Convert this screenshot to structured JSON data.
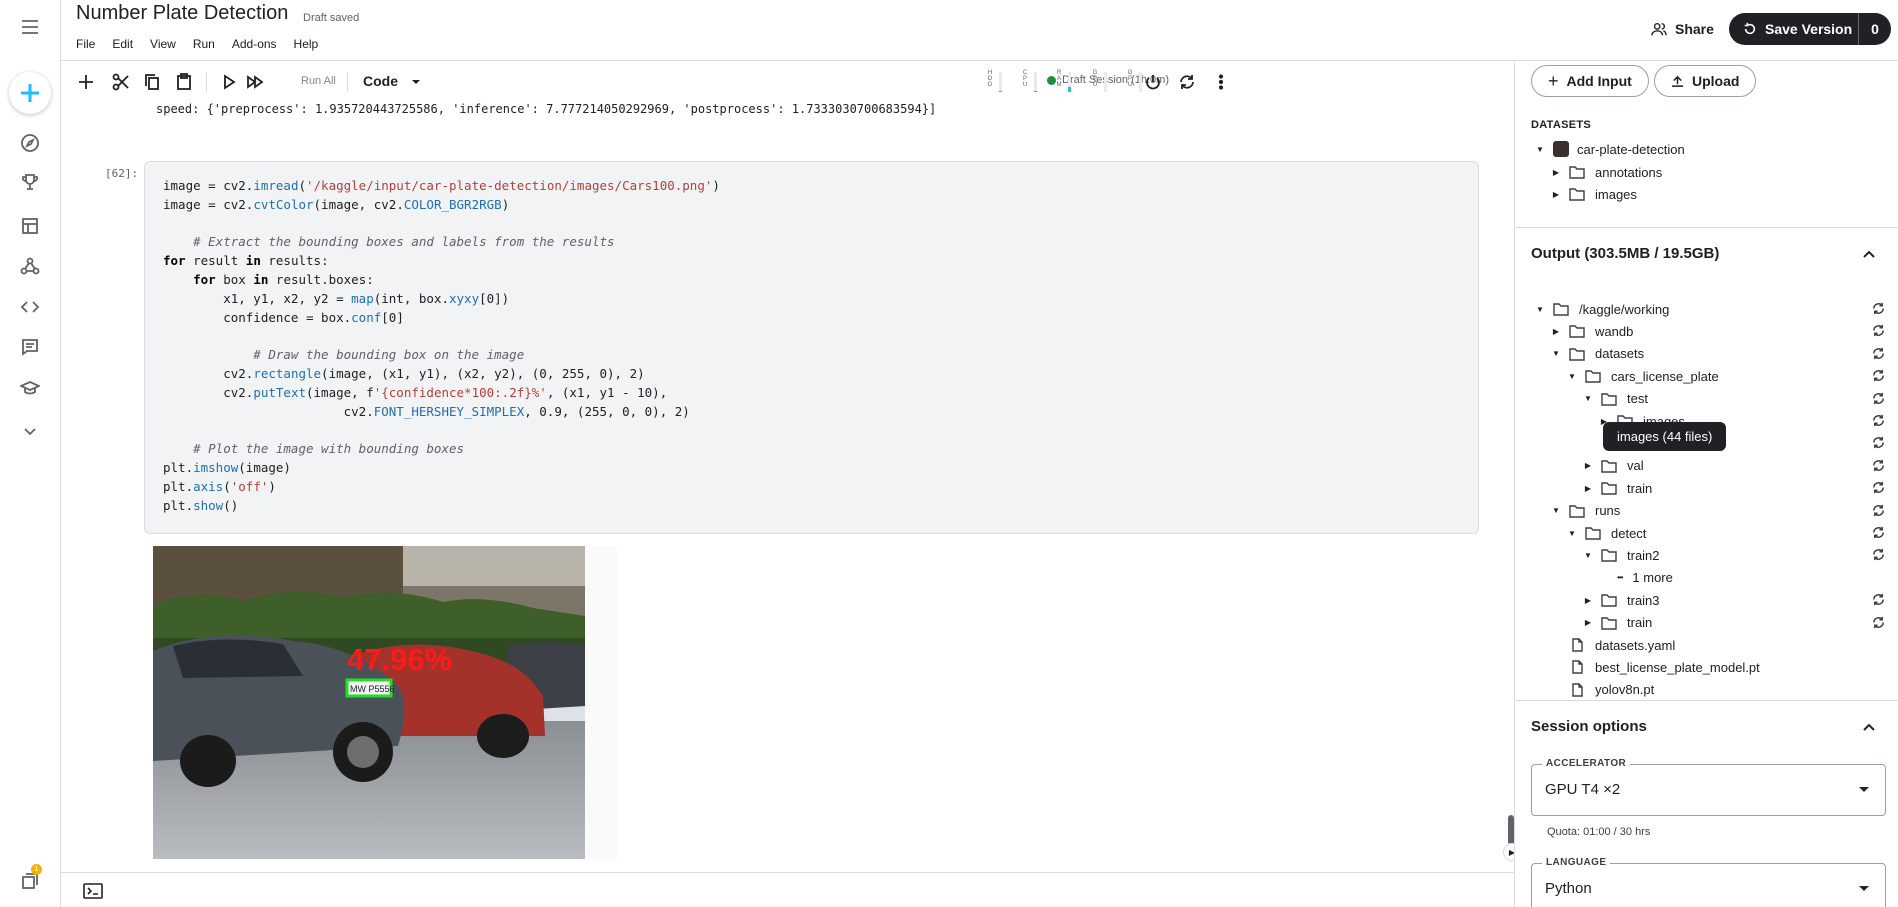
{
  "header": {
    "title": "Number Plate Detection",
    "draft_status": "Draft saved",
    "menu": [
      "File",
      "Edit",
      "View",
      "Run",
      "Add-ons",
      "Help"
    ],
    "share_label": "Share",
    "save_label": "Save Version",
    "save_count": "0"
  },
  "toolbar": {
    "run_all_label": "Run All",
    "cell_type": "Code",
    "session_label": "Draft Session (1h:0m)",
    "meters": [
      {
        "label": "HDD",
        "level": 0.05
      },
      {
        "label": "CPU",
        "level": 0.05
      },
      {
        "label": "RAM",
        "level": 0.25
      },
      {
        "label": "GPU",
        "level": 0.0
      },
      {
        "label": "GPU",
        "level": 0.0
      }
    ]
  },
  "notebook": {
    "speed_output": "speed: {'preprocess': 1.935720443725586, 'inference': 7.777214050292969, 'postprocess': 1.7333030700683594}]",
    "cell_number": "[62]:",
    "code_lines": [
      "image = cv2.imread('/kaggle/input/car-plate-detection/images/Cars100.png')",
      "image = cv2.cvtColor(image, cv2.COLOR_BGR2RGB)",
      "",
      "    # Extract the bounding boxes and labels from the results",
      "for result in results:",
      "    for box in result.boxes:",
      "        x1, y1, x2, y2 = map(int, box.xyxy[0])",
      "        confidence = box.conf[0]",
      "",
      "            # Draw the bounding box on the image",
      "        cv2.rectangle(image, (x1, y1), (x2, y2), (0, 255, 0), 2)",
      "        cv2.putText(image, f'{confidence*100:.2f}%', (x1, y1 - 10),",
      "                        cv2.FONT_HERSHEY_SIMPLEX, 0.9, (255, 0, 0), 2)",
      "",
      "    # Plot the image with bounding boxes",
      "plt.imshow(image)",
      "plt.axis('off')",
      "plt.show()"
    ],
    "output_image": {
      "confidence_text": "47.96%",
      "plate_text": "MW P5556"
    }
  },
  "panel": {
    "add_input_label": "Add Input",
    "upload_label": "Upload",
    "datasets_label": "DATASETS",
    "dataset_name": "car-plate-detection",
    "dataset_children": [
      "annotations",
      "images"
    ],
    "output_title": "Output (303.5MB / 19.5GB)",
    "output_tree": [
      {
        "label": "/kaggle/working",
        "depth": 0,
        "caret": "open",
        "type": "folder"
      },
      {
        "label": "wandb",
        "depth": 1,
        "caret": "closed",
        "type": "folder"
      },
      {
        "label": "datasets",
        "depth": 1,
        "caret": "open",
        "type": "folder"
      },
      {
        "label": "cars_license_plate",
        "depth": 2,
        "caret": "open",
        "type": "folder"
      },
      {
        "label": "test",
        "depth": 3,
        "caret": "open",
        "type": "folder"
      },
      {
        "label": "images",
        "depth": 4,
        "caret": "closed",
        "type": "folder"
      },
      {
        "label": "",
        "depth": 4,
        "caret": "none",
        "type": "hidden"
      },
      {
        "label": "val",
        "depth": 3,
        "caret": "closed",
        "type": "folder"
      },
      {
        "label": "train",
        "depth": 3,
        "caret": "closed",
        "type": "folder"
      },
      {
        "label": "runs",
        "depth": 1,
        "caret": "open",
        "type": "folder"
      },
      {
        "label": "detect",
        "depth": 2,
        "caret": "open",
        "type": "folder"
      },
      {
        "label": "train2",
        "depth": 3,
        "caret": "open",
        "type": "folder"
      },
      {
        "label": "1 more",
        "depth": 4,
        "caret": "none",
        "type": "more"
      },
      {
        "label": "train3",
        "depth": 3,
        "caret": "closed",
        "type": "folder"
      },
      {
        "label": "train",
        "depth": 3,
        "caret": "closed",
        "type": "folder"
      },
      {
        "label": "datasets.yaml",
        "depth": 1,
        "caret": "none",
        "type": "file"
      },
      {
        "label": "best_license_plate_model.pt",
        "depth": 1,
        "caret": "none",
        "type": "file"
      },
      {
        "label": "yolov8n.pt",
        "depth": 1,
        "caret": "none",
        "type": "file"
      }
    ],
    "tooltip": "images (44 files)",
    "session_title": "Session options",
    "accelerator_label": "ACCELERATOR",
    "accelerator_value": "GPU T4 ×2",
    "quota": "Quota: 01:00 / 30 hrs",
    "language_label": "LANGUAGE",
    "language_value": "Python"
  },
  "rail": {
    "icons": [
      "menu-icon",
      "create-icon",
      "compass-icon",
      "trophy-icon",
      "table-icon",
      "models-icon",
      "code-icon",
      "comments-icon",
      "learn-icon",
      "more-icon",
      "notifications-icon"
    ],
    "notification_count": "1"
  },
  "colors": {
    "accent": "#20beff",
    "save_button": "#202124",
    "session_dot": "#1e8e3e",
    "confidence_text": "#ff1a1a",
    "box": "#22dd22"
  }
}
